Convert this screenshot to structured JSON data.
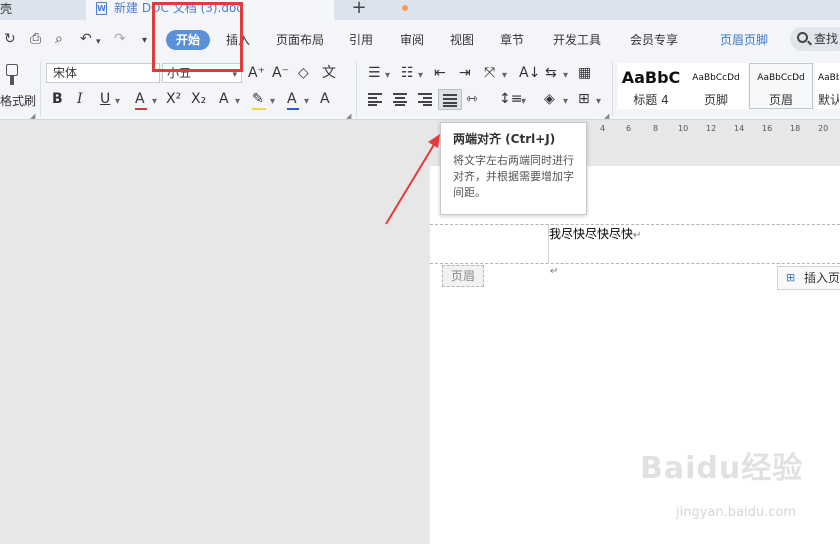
{
  "tabbar": {
    "home_tab_label": "壳",
    "doc_icon_letter": "W",
    "doc_title": "新建 DOC 文档 (3).doc",
    "new_tab_symbol": "+"
  },
  "menu": {
    "items": [
      "开始",
      "插入",
      "页面布局",
      "引用",
      "审阅",
      "视图",
      "章节",
      "开发工具",
      "会员专享",
      "页眉页脚"
    ],
    "search_label": "查找"
  },
  "ribbon": {
    "format_painter_label": "格式刷",
    "font_name": "宋体",
    "font_size": "小五",
    "styles": [
      {
        "sample": "AaBbC",
        "label": "标题 4"
      },
      {
        "sample": "AaBbCcDd",
        "label": "页脚"
      },
      {
        "sample": "AaBbCcDd",
        "label": "页眉"
      },
      {
        "sample": "AaBbCcDd",
        "label": "默认"
      }
    ]
  },
  "ruler": {
    "ticks": [
      "4",
      "6",
      "8",
      "10",
      "12",
      "14",
      "16",
      "18",
      "20"
    ]
  },
  "tooltip": {
    "title": "两端对齐 (Ctrl+J)",
    "body": "将文字左右两端同时进行对齐，并根据需要增加字间距。"
  },
  "document": {
    "header_text": "我尽快尽快尽快",
    "paragraph_mark": "↵",
    "header_tag": "页眉",
    "insert_button_label": "插入页"
  },
  "watermark": {
    "main": "Baidu经验",
    "sub": "jingyan.baidu.com"
  },
  "colors": {
    "accent": "#5a90d8",
    "highlight": "#e23b3b",
    "header_link": "#3a76c9"
  }
}
